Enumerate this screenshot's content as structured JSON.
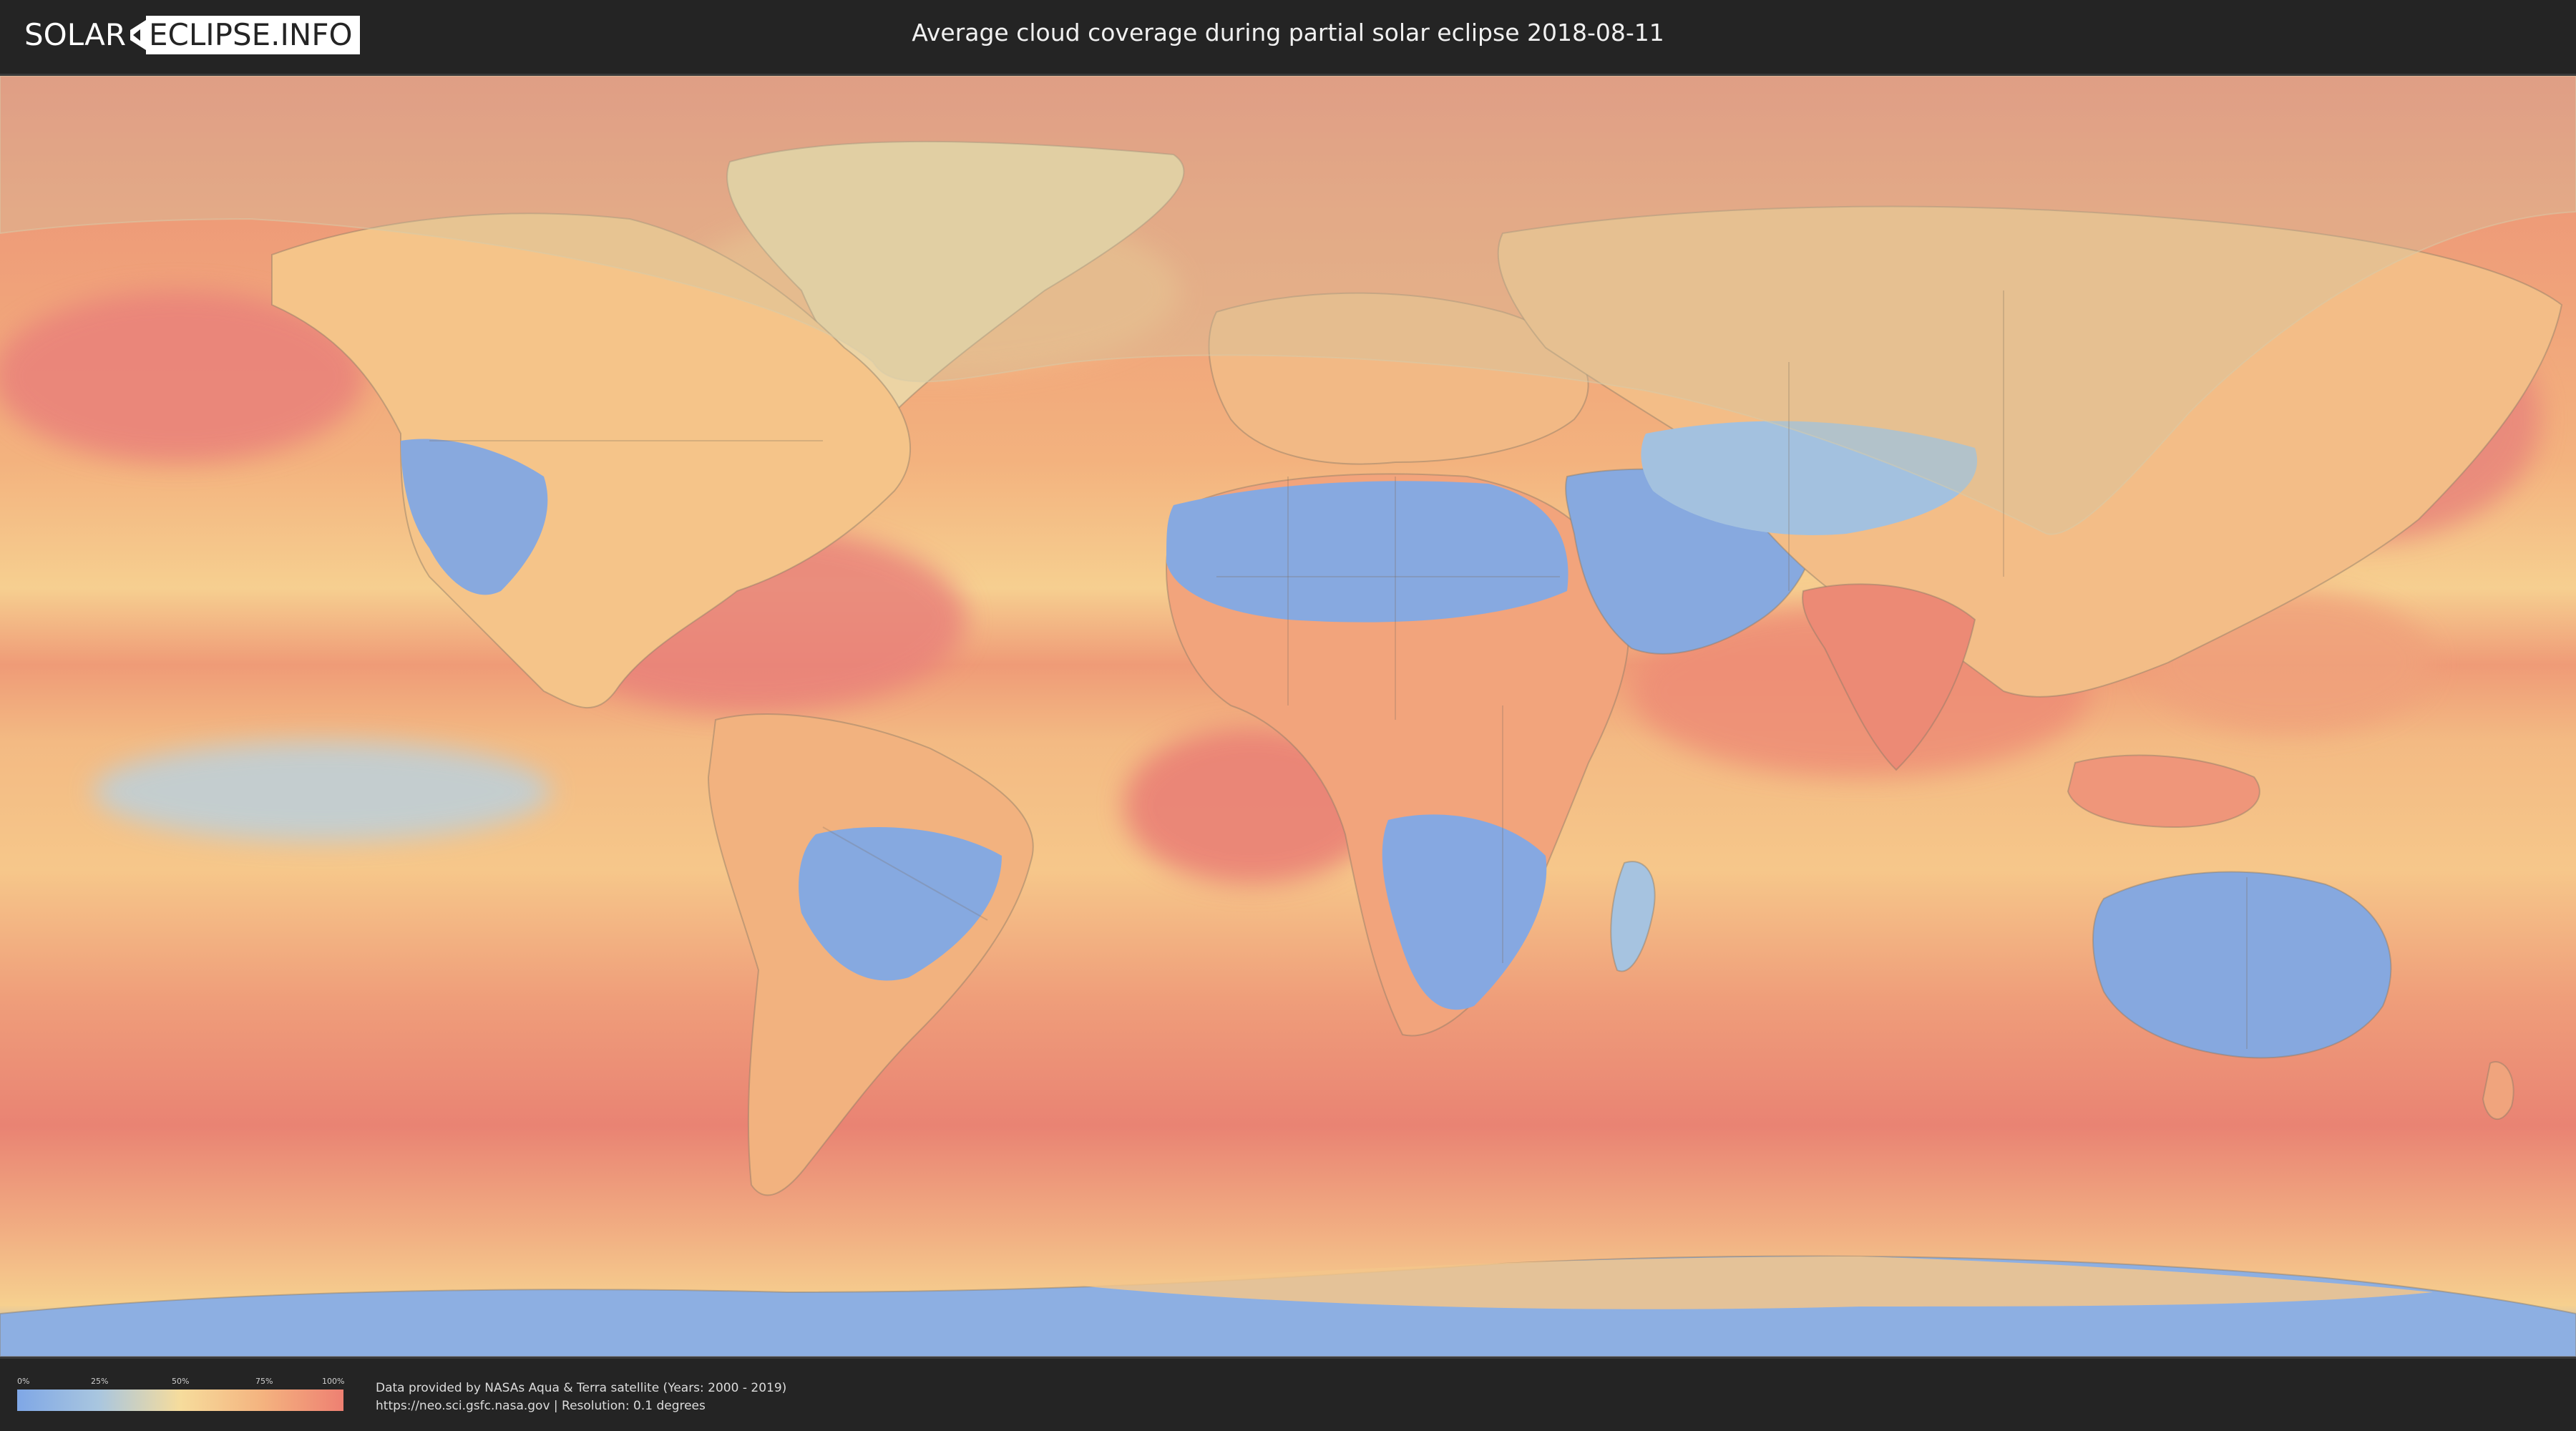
{
  "header": {
    "logo_left": "SOLAR",
    "logo_right": "ECLIPSE.INFO",
    "title": "Average cloud coverage during partial solar eclipse 2018-08-11"
  },
  "legend": {
    "labels": [
      "0%",
      "25%",
      "50%",
      "75%",
      "100%"
    ],
    "colors": [
      "#7fa7e6",
      "#a9c6df",
      "#f6dc9c",
      "#f4b37f",
      "#ee8072"
    ]
  },
  "credits": {
    "line1": "Data provided by NASAs Aqua & Terra satellite (Years: 2000 - 2019)",
    "line2": "https://neo.sci.gsfc.nasa.gov | Resolution: 0.1 degrees"
  },
  "map": {
    "projection": "equirectangular",
    "layers": [
      "cloud-coverage",
      "country-borders",
      "eclipse-visibility-area"
    ],
    "colors": {
      "ocean_cloudy": "#eb8f72",
      "land_mid": "#f5c68c",
      "clear": "#84a8e0",
      "eclipse_overlay": "#d7c79a"
    }
  }
}
